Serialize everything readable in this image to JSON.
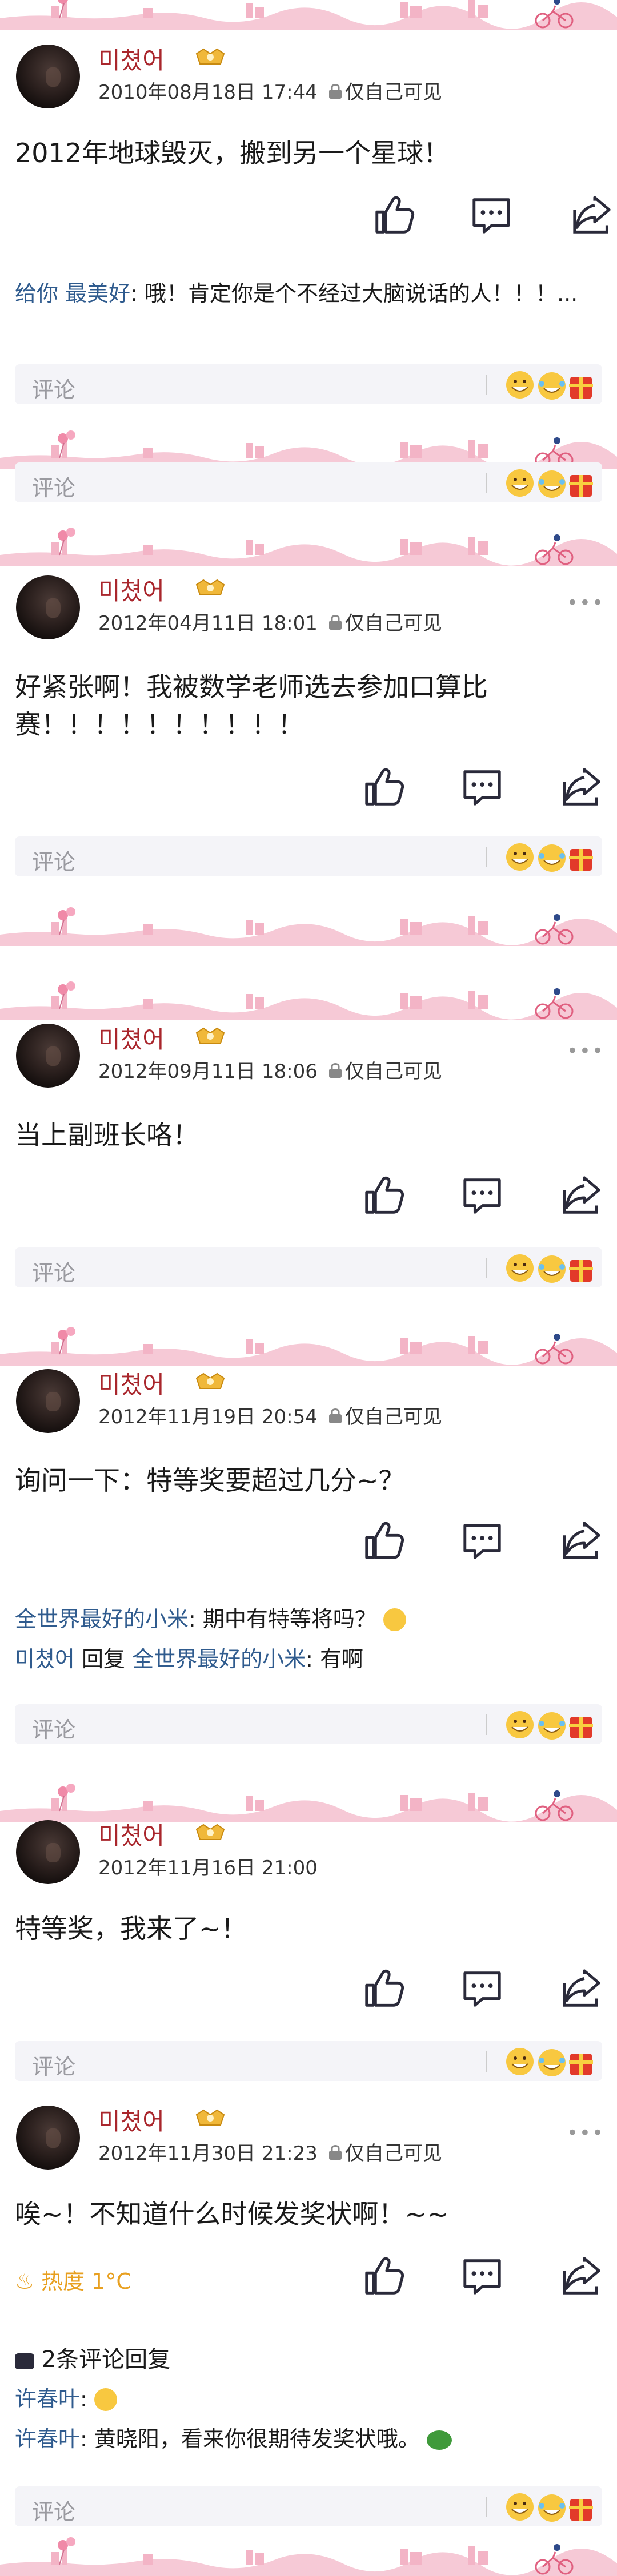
{
  "posts": [
    {
      "username": "미쳤어",
      "date": "2010年08月18日 17:44",
      "visibility": "仅自己可见",
      "content": "2012年地球毁灭，搬到另一个星球！",
      "comment_lines": [
        {
          "prefix": "给你",
          "author": "最美好",
          "text": ": 哦！肯定你是个不经过大脑说话的人！！！..."
        }
      ],
      "comment_placeholder": "评论"
    },
    {
      "username": "미쳤어",
      "date": "2012年04月11日 18:01",
      "visibility": "仅自己可见",
      "content": "好紧张啊！我被数学老师选去参加口算比赛！！！！！！！！！！",
      "comment_placeholder": "评论"
    },
    {
      "username": "미쳤어",
      "date": "2012年09月11日 18:06",
      "visibility": "仅自己可见",
      "content": "当上副班长咯！",
      "comment_placeholder": "评论"
    },
    {
      "username": "미쳤어",
      "date": "2012年11月19日 20:54",
      "visibility": "仅自己可见",
      "content": "询问一下：特等奖要超过几分~？",
      "comment_lines": [
        {
          "author": "全世界最好的小米",
          "text": ": 期中有特等将吗？"
        },
        {
          "author": "미쳤어",
          "reply_word": " 回复 ",
          "reply_to": "全世界最好的小米",
          "text": ": 有啊"
        }
      ],
      "comment_placeholder": "评论"
    },
    {
      "username": "미쳤어",
      "date": "2012年11月16日 21:00",
      "visibility": "",
      "content": "特等奖，我来了~！",
      "comment_placeholder": "评论"
    },
    {
      "username": "미쳤어",
      "date": "2012年11月30日 21:23",
      "visibility": "仅自己可见",
      "content": "唉~！不知道什么时候发奖状啊！~~",
      "heat": "热度 1°C",
      "replies_label": "2条评论回复",
      "comment_lines": [
        {
          "author": "许春叶",
          "text": ":"
        },
        {
          "author": "许春叶",
          "text": ": 黄晓阳，看来你很期待发奖状哦。"
        }
      ],
      "comment_placeholder": "评论"
    }
  ],
  "extra_comment_placeholder": "评论",
  "colors": {
    "username": "#a9262c",
    "link": "#2f5b8e",
    "heat": "#e8a020",
    "band_pink": "#f3b4c6"
  }
}
